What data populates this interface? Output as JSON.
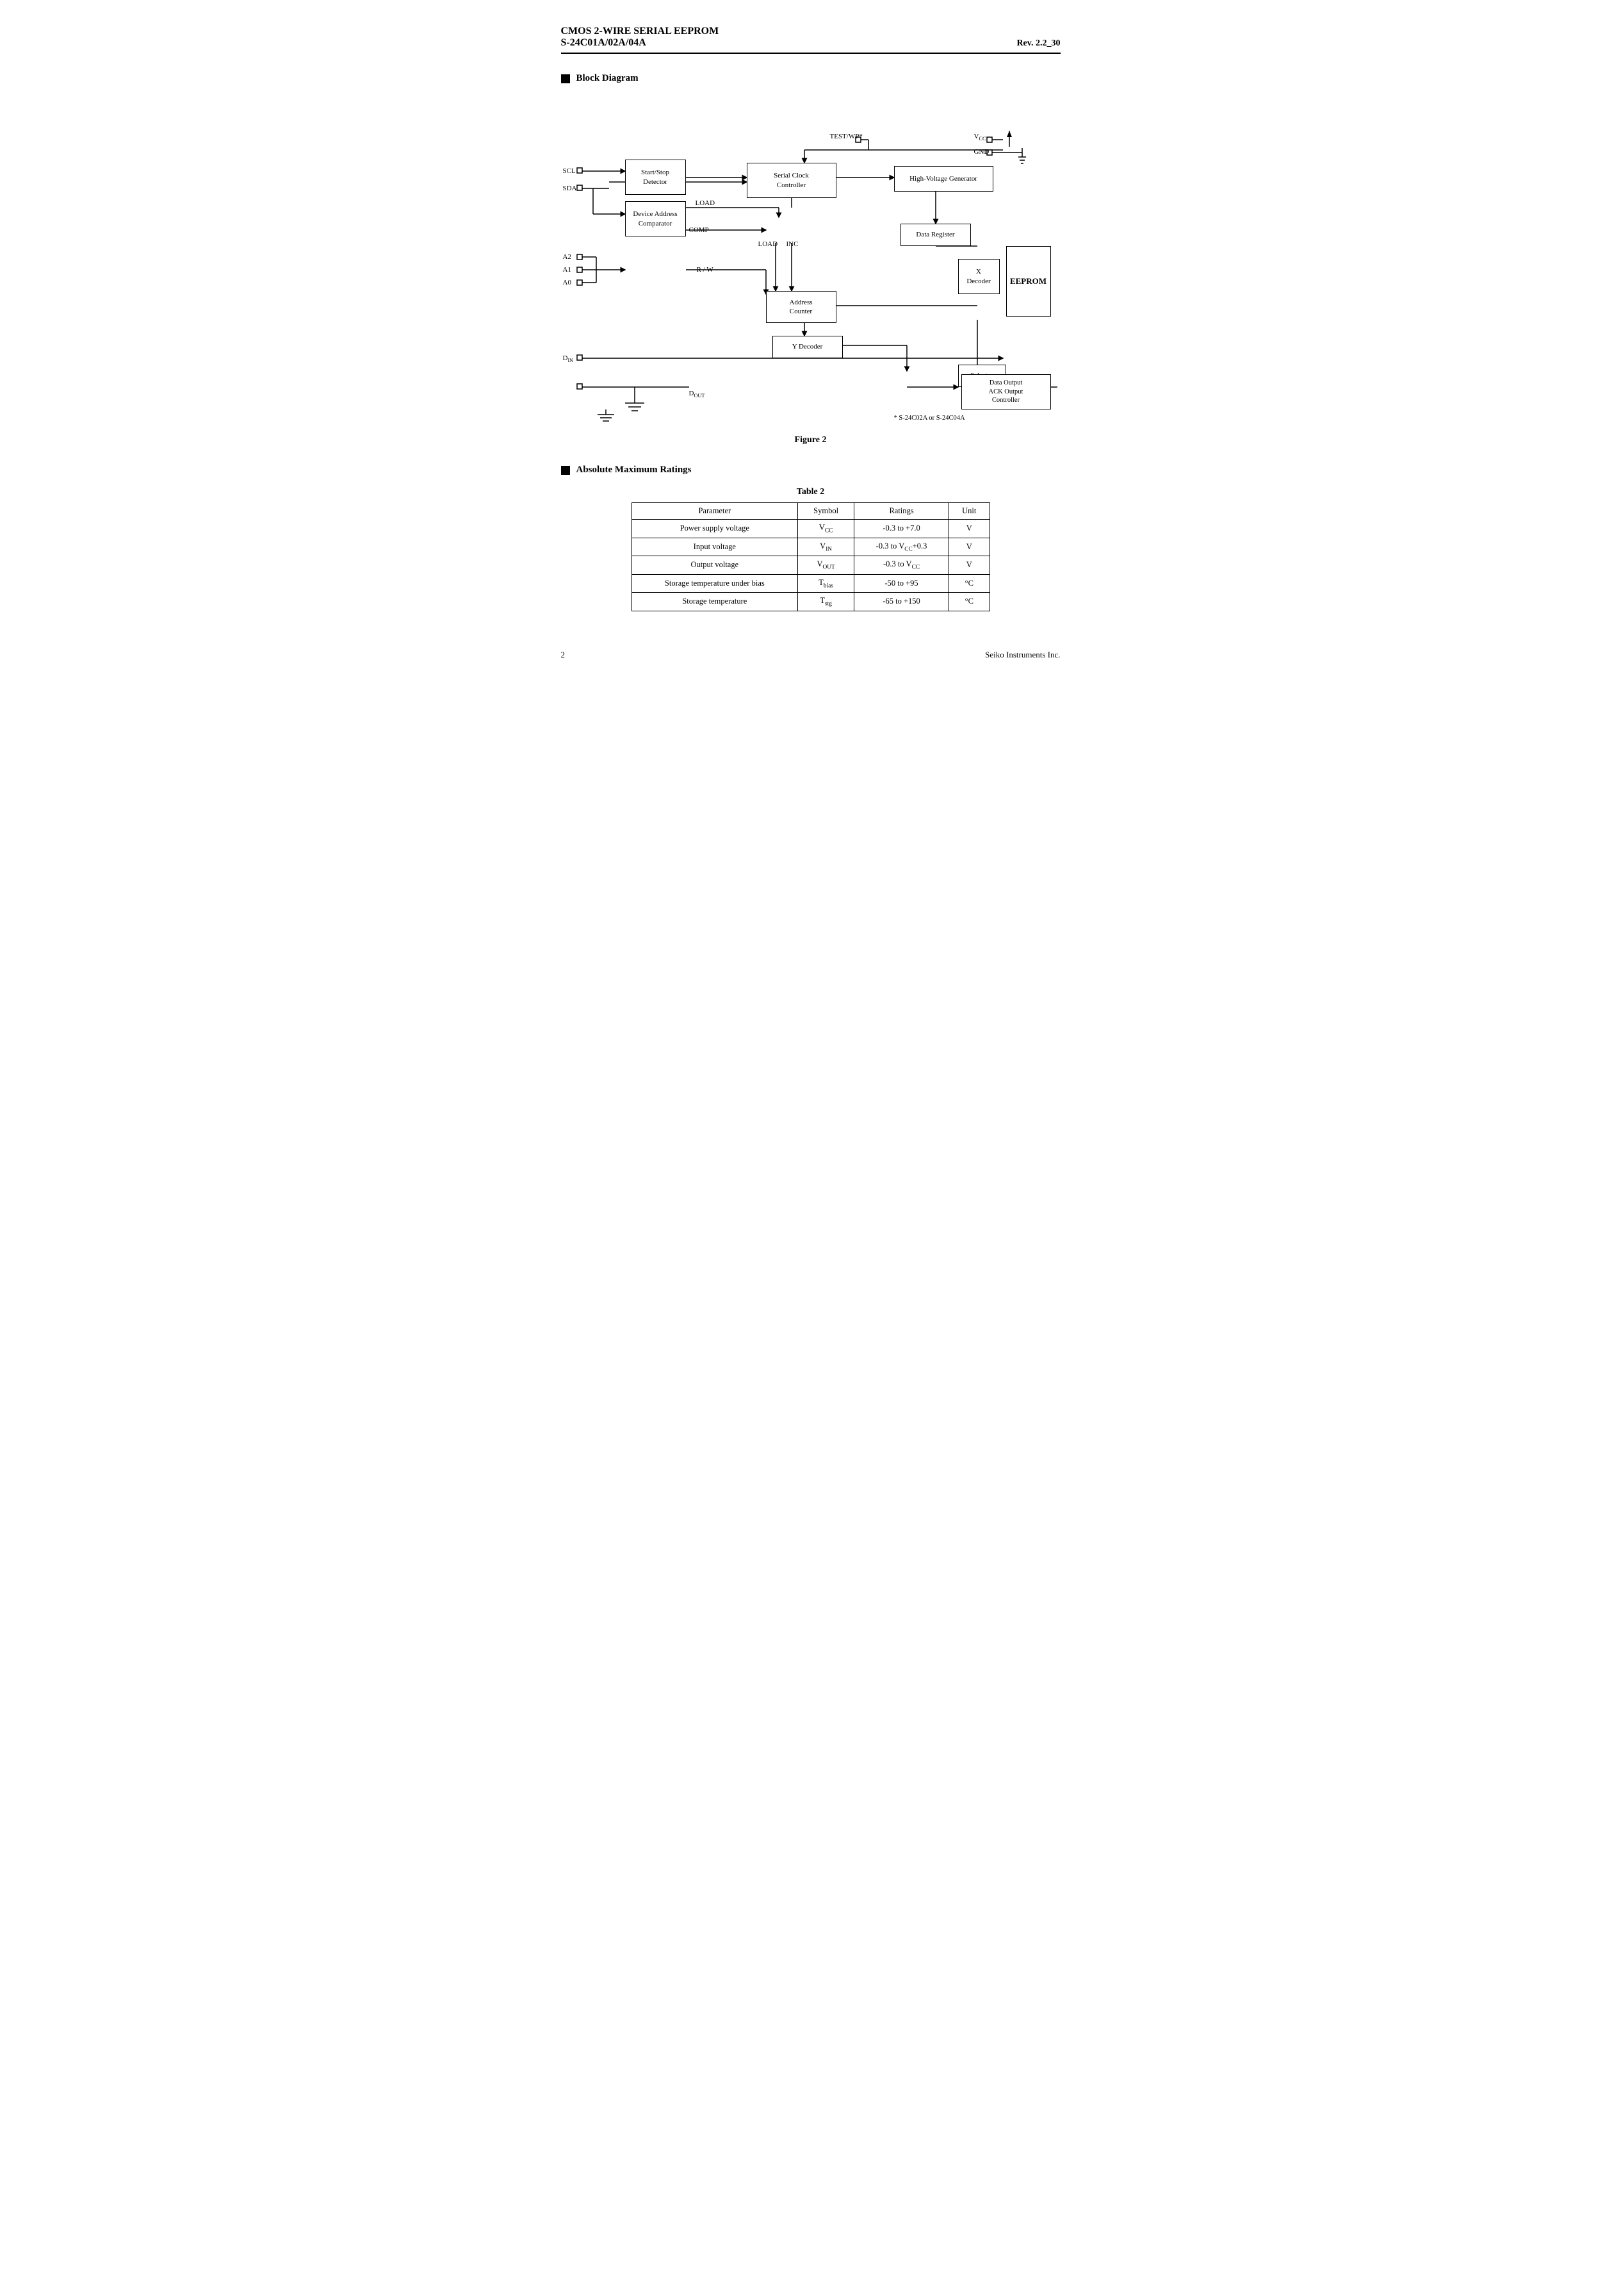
{
  "header": {
    "title_line1": "CMOS 2-WIRE SERIAL  EEPROM",
    "title_line2": "S-24C01A/02A/04A",
    "rev": "Rev. 2.2_30"
  },
  "block_diagram": {
    "section_label": "Block Diagram",
    "figure_caption": "Figure 2",
    "boxes": {
      "start_stop": "Start/Stop\nDetector",
      "serial_clock": "Serial Clock\nController",
      "high_voltage": "High-Voltage Generator",
      "device_address": "Device Address\nComparator",
      "data_register": "Data Register",
      "x_decoder": "X\nDecoder",
      "eeprom": "EEPROM",
      "address_counter": "Address\nCounter",
      "y_decoder": "Y Decoder",
      "selector": "Selector",
      "data_output": "Data Output\nACK Output\nController"
    },
    "pin_labels": {
      "scl": "SCL",
      "sda": "SDA",
      "a2": "A2",
      "a1": "A1",
      "a0": "A0",
      "din": "Dₙ",
      "dout": "Dₒᵤᴴ",
      "test_wp": "TEST/WP*",
      "vcc": "Vᴄᴄ",
      "gnd": "GND"
    },
    "signal_labels": {
      "load": "LOAD",
      "comp": "COMP",
      "load2": "LOAD",
      "inc": "INC",
      "rw": "R / W",
      "footnote": "*  S-24C02A or S-24C04A"
    }
  },
  "table": {
    "title": "Table  2",
    "columns": [
      "Parameter",
      "Symbol",
      "Ratings",
      "Unit"
    ],
    "rows": [
      [
        "Power supply voltage",
        "Vᴄᴄ",
        "-0.3 to +7.0",
        "V"
      ],
      [
        "Input voltage",
        "Vᴵₙ",
        "-0.3 to Vᴄᴄ+0.3",
        "V"
      ],
      [
        "Output voltage",
        "Vₒᵁᴴ",
        "-0.3 to Vᴄᴄ",
        "V"
      ],
      [
        "Storage temperature under bias",
        "Tᵇᴵᵃˢ",
        "-50 to +95",
        "°C"
      ],
      [
        "Storage temperature",
        "Tˢᵗ὜",
        "-65 to +150",
        "°C"
      ]
    ]
  },
  "absolute_ratings": {
    "section_label": "Absolute Maximum Ratings"
  },
  "footer": {
    "page_number": "2",
    "company": "Seiko Instruments Inc."
  }
}
